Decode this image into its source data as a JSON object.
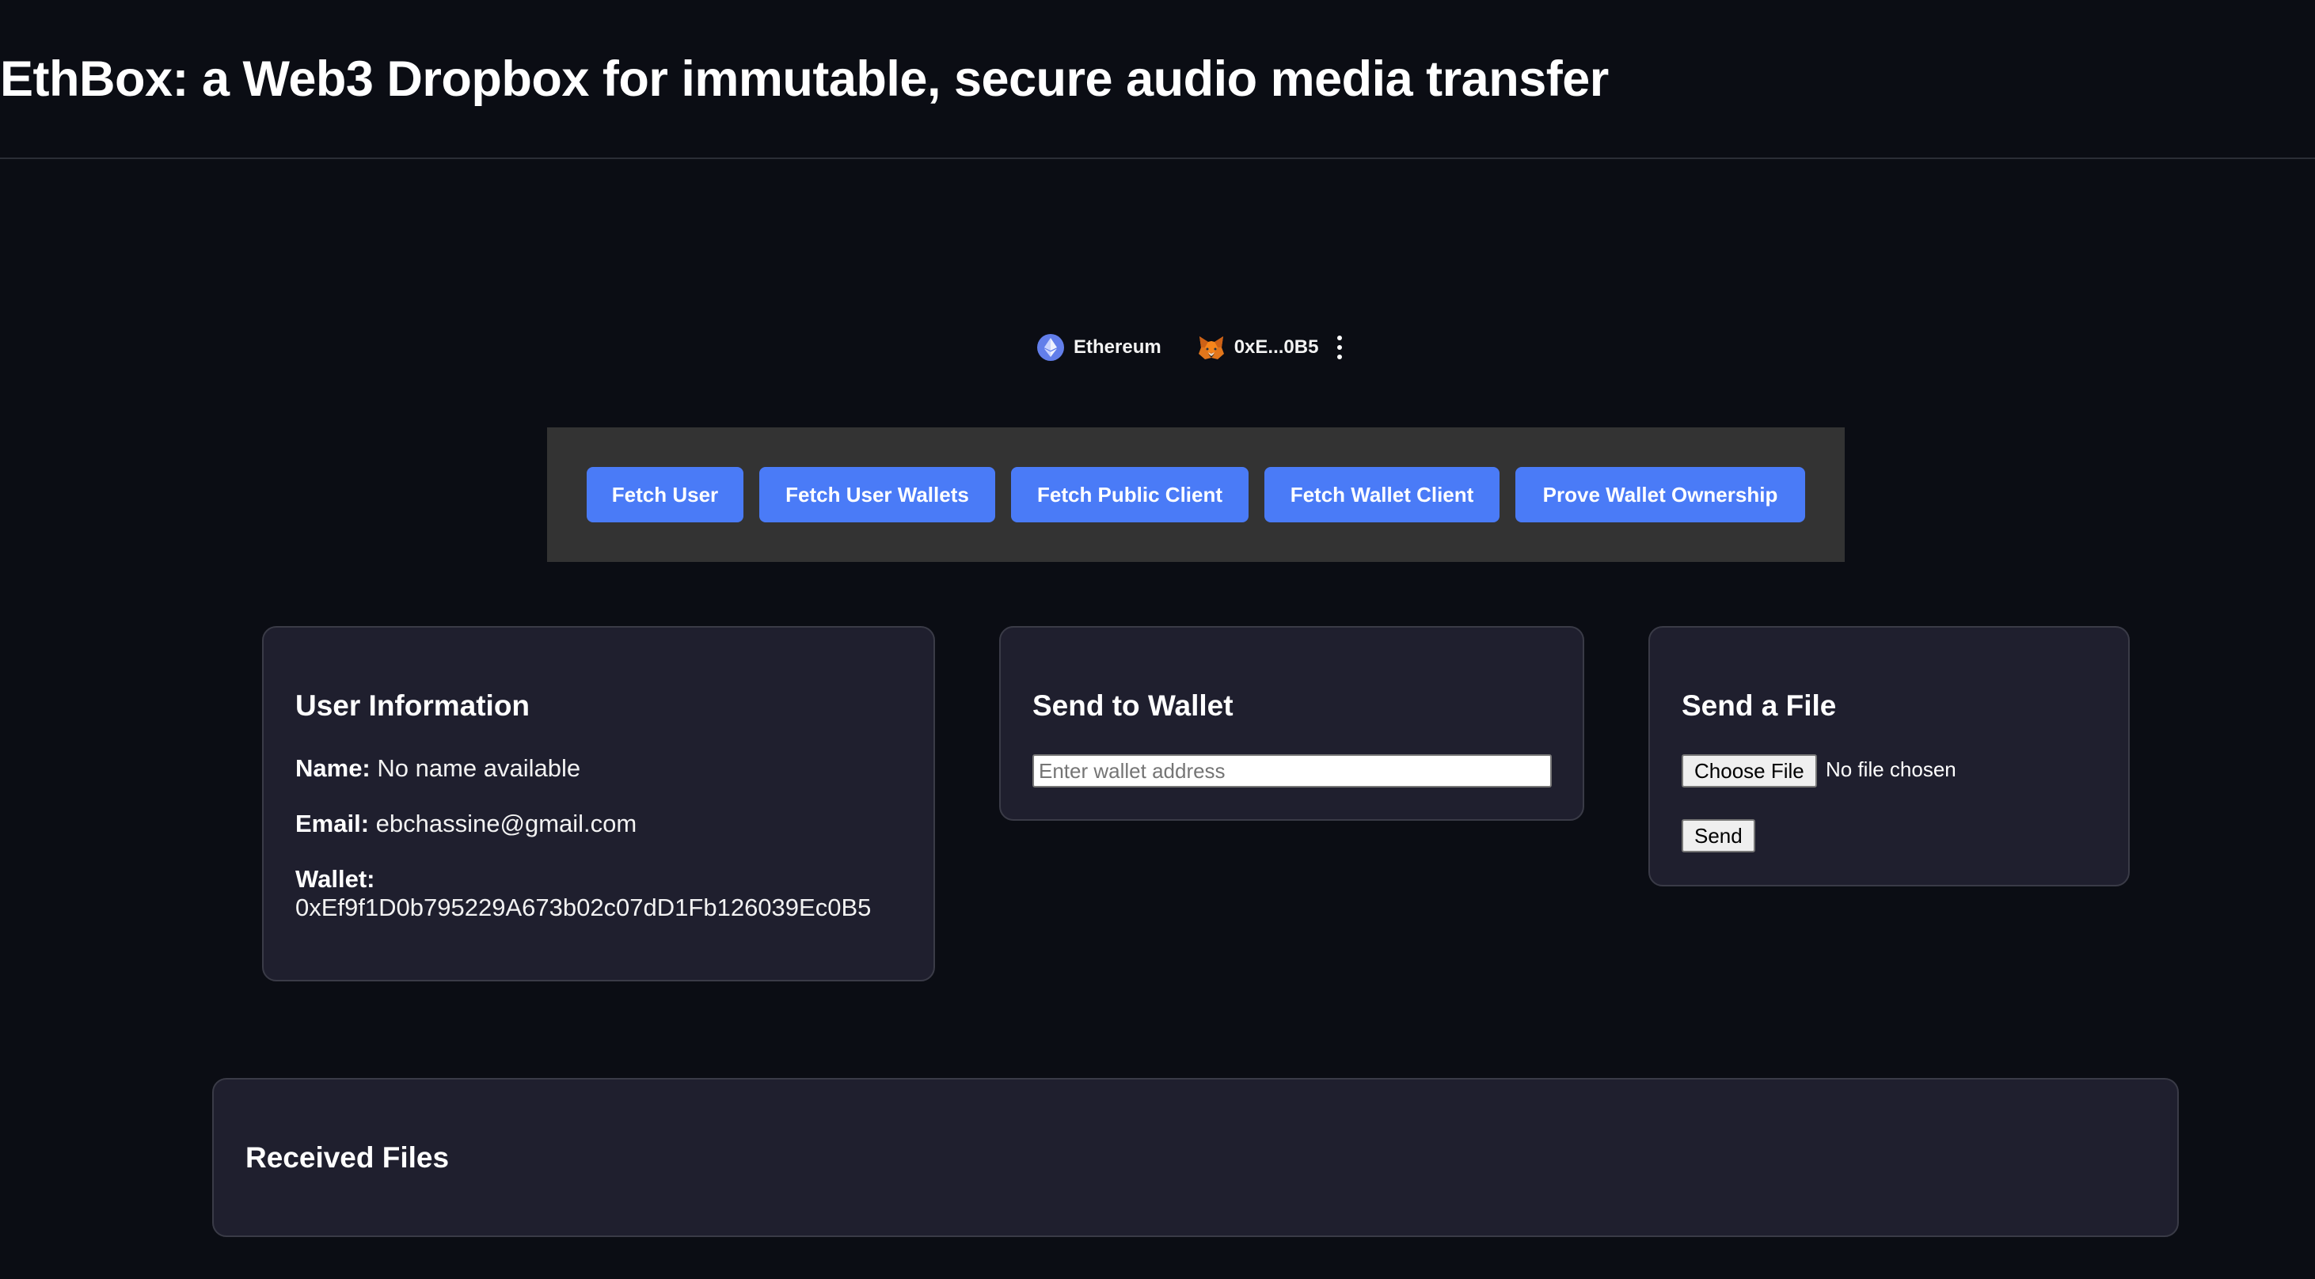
{
  "header": {
    "title": "EthBox: a Web3 Dropbox for immutable, secure audio media transfer"
  },
  "wallet_bar": {
    "chain_icon": "ethereum-icon",
    "chain_label": "Ethereum",
    "account_icon": "metamask-fox-icon",
    "account_label": "0xE...0B5",
    "menu_icon": "kebab-menu-icon"
  },
  "actions": {
    "buttons": [
      {
        "label": "Fetch User"
      },
      {
        "label": "Fetch User Wallets"
      },
      {
        "label": "Fetch Public Client"
      },
      {
        "label": "Fetch Wallet Client"
      },
      {
        "label": "Prove Wallet Ownership"
      }
    ],
    "button_color": "#4a7bf7"
  },
  "user_info": {
    "title": "User Information",
    "name_label": "Name:",
    "name_value": "No name available",
    "email_label": "Email:",
    "email_value": "ebchassine@gmail.com",
    "wallet_label": "Wallet:",
    "wallet_value": "0xEf9f1D0b795229A673b02c07dD1Fb126039Ec0B5"
  },
  "send_to_wallet": {
    "title": "Send to Wallet",
    "input_value": "",
    "input_placeholder": "Enter wallet address"
  },
  "send_file": {
    "title": "Send a File",
    "choose_file_label": "Choose File",
    "file_status": "No file chosen",
    "send_label": "Send"
  },
  "received_files": {
    "title": "Received Files",
    "items": []
  }
}
